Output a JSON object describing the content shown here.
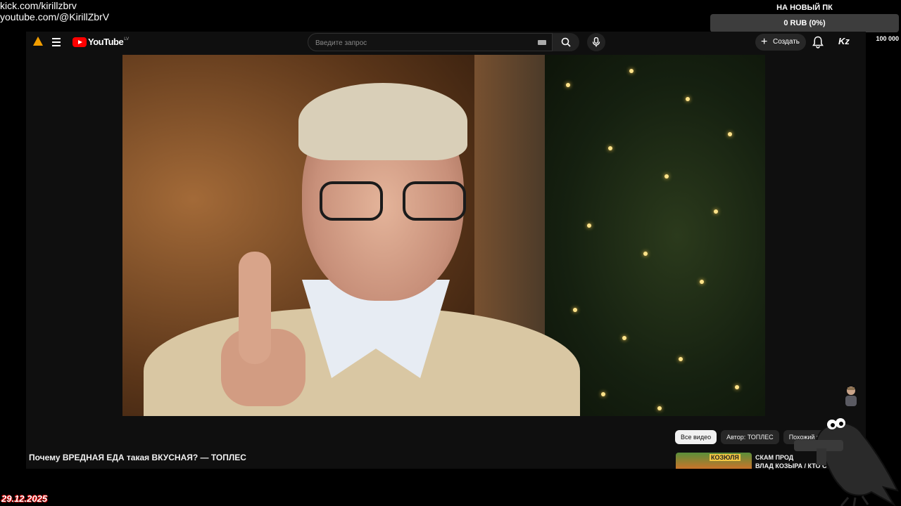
{
  "overlay": {
    "social": [
      "kick.com/kirillzbrv",
      "youtube.com/@KirillZbrV"
    ],
    "goal": {
      "title": "НА НОВЫЙ ПК",
      "value_text": "0 RUB (0%)",
      "progress_percent": 0,
      "min": "0",
      "max": "100 000"
    },
    "date": "29.12.2025"
  },
  "youtube": {
    "logo_text": "YouTube",
    "country_code": "LV",
    "search": {
      "placeholder": "Введите запрос",
      "value": ""
    },
    "create_label": "Создать",
    "account_initials": "Kz",
    "video_title": "Почему ВРЕДНАЯ ЕДА такая ВКУСНАЯ? — ТОПЛЕС",
    "chips": [
      "Все видео",
      "Автор: ТОПЛЕС",
      "Похожий к"
    ],
    "active_chip": 0,
    "recommendation": {
      "thumbnail_text": "КОЗЮЛЯ",
      "title_line1": "СКАМ ПРОД",
      "title_line2": "ВЛАД КОЗЫРА / КТО СТОИ"
    }
  },
  "icons": [
    "warning-icon",
    "menu-icon",
    "youtube-logo-icon",
    "keyboard-icon",
    "search-icon",
    "mic-icon",
    "plus-icon",
    "bell-icon",
    "crow-mascot-icon"
  ],
  "colors": {
    "accent_red": "#ff0000",
    "warning": "#f29e00",
    "bg": "#0f0f0f",
    "goal_bar": "#3d3d3d"
  }
}
